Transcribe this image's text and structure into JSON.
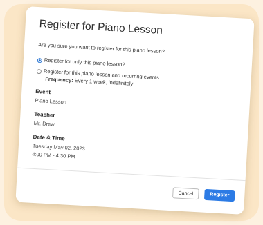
{
  "dialog": {
    "title": "Register for Piano Lesson",
    "question": "Are you sure you want to register for this piano lesson?",
    "options": [
      {
        "label": "Register for only this piano lesson?",
        "selected": true
      },
      {
        "label": "Register for this piano lesson and recurring events",
        "selected": false
      }
    ],
    "frequency_label": "Frequency:",
    "frequency_value": "Every 1 week, indefinitely",
    "event_label": "Event",
    "event_value": "Piano Lesson",
    "teacher_label": "Teacher",
    "teacher_value": "Mr. Drew",
    "datetime_label": "Date & Time",
    "date_value": "Tuesday May 02, 2023",
    "time_value": "4:00 PM - 4:30 PM",
    "cancel_label": "Cancel",
    "register_label": "Register"
  },
  "colors": {
    "accent": "#2c7be5",
    "background": "#fdf1e0"
  }
}
